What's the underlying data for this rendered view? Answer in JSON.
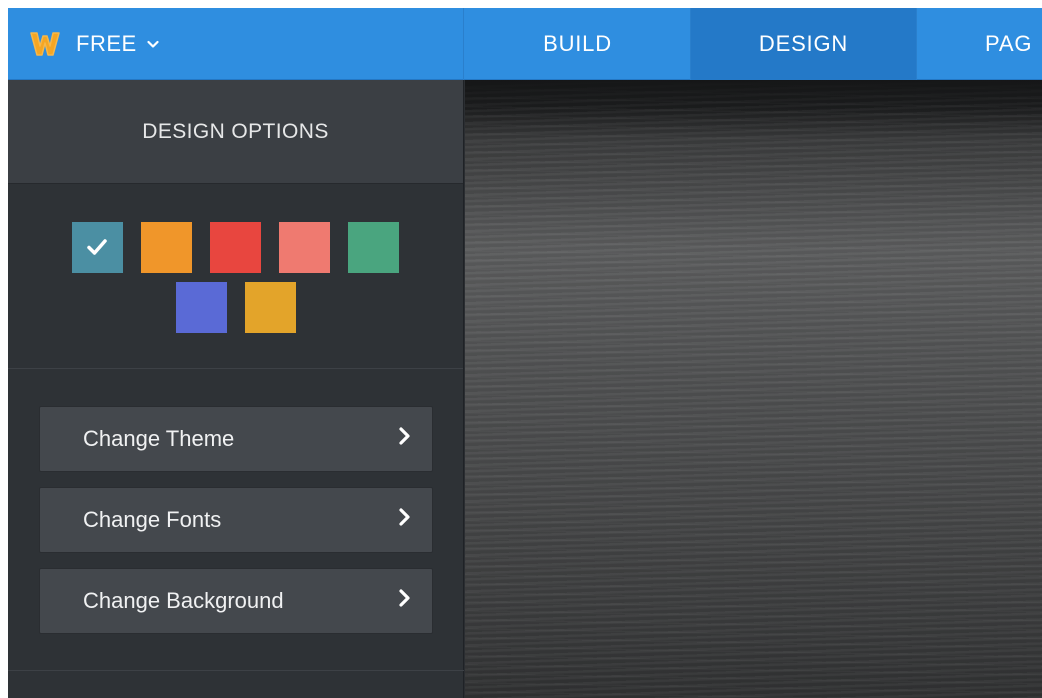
{
  "topbar": {
    "plan_label": "FREE",
    "logo_icon": "weebly-w-logo",
    "tabs": [
      {
        "label": "BUILD",
        "active": false
      },
      {
        "label": "DESIGN",
        "active": true
      },
      {
        "label": "PAG",
        "active": false
      }
    ]
  },
  "sidebar": {
    "title": "DESIGN OPTIONS",
    "swatches": [
      {
        "color": "#4b8fa3",
        "selected": true
      },
      {
        "color": "#f0962a",
        "selected": false
      },
      {
        "color": "#e8463f",
        "selected": false
      },
      {
        "color": "#ef7a70",
        "selected": false
      },
      {
        "color": "#4aa57f",
        "selected": false
      },
      {
        "color": "#5a6ad6",
        "selected": false
      },
      {
        "color": "#e3a42a",
        "selected": false
      }
    ],
    "options": [
      {
        "label": "Change Theme",
        "icon": "chevron-right-icon"
      },
      {
        "label": "Change Fonts",
        "icon": "chevron-right-icon"
      },
      {
        "label": "Change Background",
        "icon": "chevron-right-icon"
      }
    ]
  },
  "colors": {
    "topbar": "#2f8ee0",
    "active_tab": "#2479c8",
    "sidebar": "#2e3236",
    "logo": "#f5a623"
  }
}
